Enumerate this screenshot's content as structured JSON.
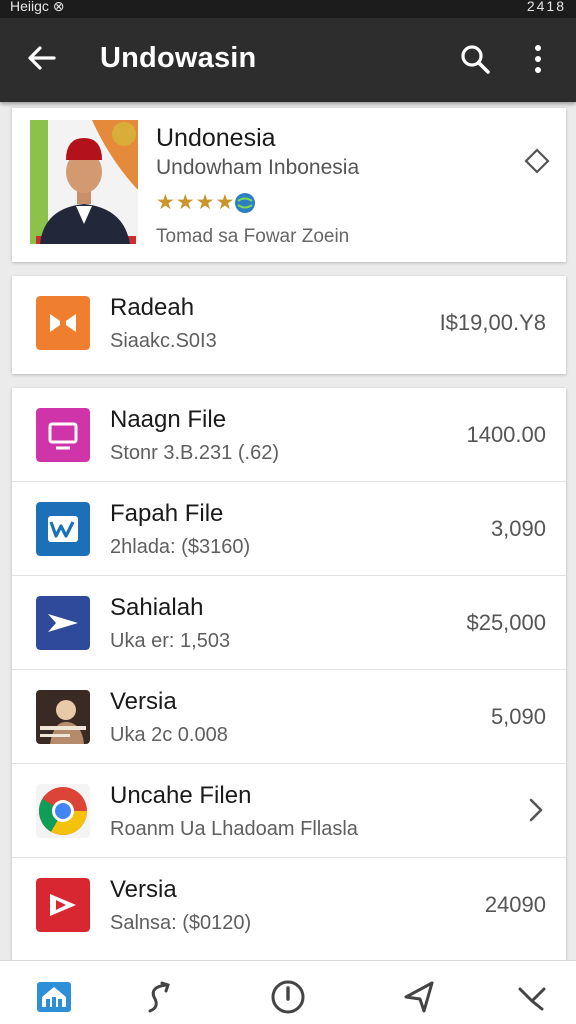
{
  "status_bar": {
    "carrier": "Heiigc ⊗",
    "time": "2418"
  },
  "app_bar": {
    "title": "Undowasin"
  },
  "hero": {
    "name": "Undonesia",
    "subtitle": "Undowham Inbonesia",
    "stars": "★★★★",
    "rating": 4,
    "meta": "Tomad sa Fowar Zoein"
  },
  "single_item": {
    "label": "Radeah",
    "sub": "Siaakc.S0I3",
    "value": "I$19,00.Y8",
    "icon": "share-box-icon",
    "color": "#ef7f2f"
  },
  "items": [
    {
      "label": "Naagn File",
      "sub": "Stonr 3.B.231 (.62)",
      "value": "1400.00",
      "icon": "screen-icon",
      "color": "#cf35a9"
    },
    {
      "label": "Fapah File",
      "sub": "2hlada: ($3160)",
      "value": "3,090",
      "icon": "w-logo-icon",
      "color": "#1c70b8"
    },
    {
      "label": "Sahialah",
      "sub": "Uka er: 1,503",
      "value": "$25,000",
      "icon": "plane-icon",
      "color": "#2f4a9a"
    },
    {
      "label": "Versia",
      "sub": "Uka 2c 0.008",
      "value": "5,090",
      "icon": "photo-thumbnail-icon",
      "color": "#3a2a24"
    },
    {
      "label": "Uncahe Filen",
      "sub": "Roanm Ua Lhadoam Fllasla",
      "value": "",
      "icon": "chrome-icon",
      "color": "#4285f4"
    },
    {
      "label": "Versia",
      "sub": "Salnsa: ($0120)",
      "value": "24090",
      "icon": "play-box-icon",
      "color": "#d92731"
    }
  ],
  "bottom_nav": [
    "home-icon",
    "share-icon",
    "info-icon",
    "send-icon",
    "close-icon"
  ]
}
